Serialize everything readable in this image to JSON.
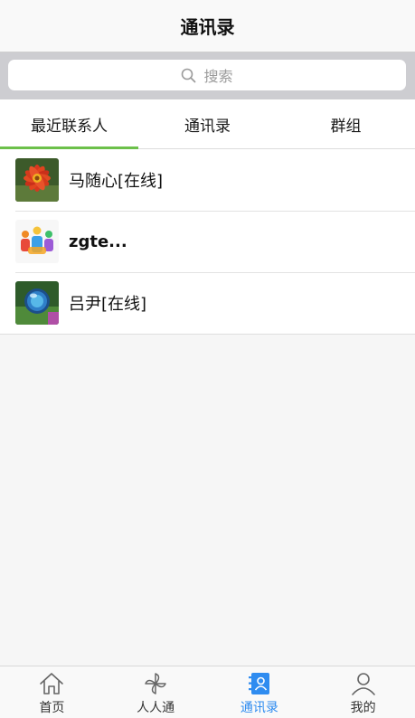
{
  "header": {
    "title": "通讯录"
  },
  "search": {
    "placeholder": "搜索"
  },
  "tabs": [
    {
      "label": "最近联系人",
      "active": true
    },
    {
      "label": "通讯录",
      "active": false
    },
    {
      "label": "群组",
      "active": false
    }
  ],
  "contacts": [
    {
      "name": "马随心",
      "status": "[在线]",
      "avatar": "red-flower-photo"
    },
    {
      "name": "zgte...",
      "status": "",
      "avatar": "colorful-people-logo"
    },
    {
      "name": "吕尹",
      "status": "[在线]",
      "avatar": "glass-sphere-photo"
    }
  ],
  "tabbar": [
    {
      "label": "首页",
      "icon": "home-icon",
      "active": false
    },
    {
      "label": "人人通",
      "icon": "pinwheel-icon",
      "active": false
    },
    {
      "label": "通讯录",
      "icon": "contacts-book-icon",
      "active": true
    },
    {
      "label": "我的",
      "icon": "person-icon",
      "active": false
    }
  ],
  "colors": {
    "accent_green": "#6cc04a",
    "active_blue": "#2f8cf0"
  }
}
